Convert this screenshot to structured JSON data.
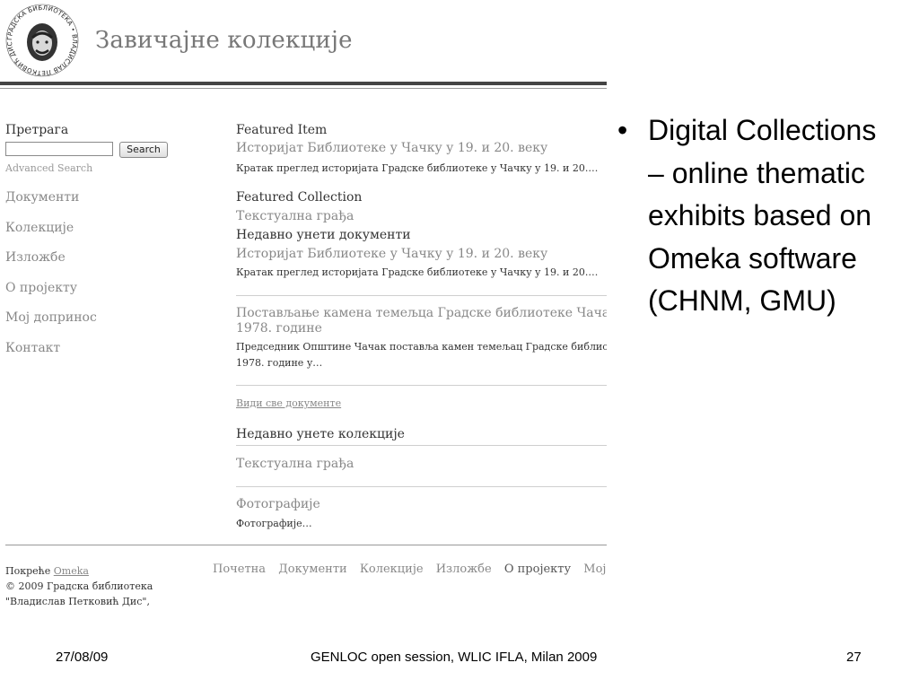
{
  "site": {
    "title": "Завичајне колекције",
    "logo_text": "ГРАДСКА БИБЛИОТЕКА • ВЛАДИСЛАВ ПЕТКОВИЋ ДИС • ЧАЧАК"
  },
  "sidebar": {
    "search_heading": "Претрага",
    "search_value": "",
    "search_button": "Search",
    "advanced_search": "Advanced Search",
    "nav": [
      "Документи",
      "Колекције",
      "Изложбе",
      "О пројекту",
      "Мој допринос",
      "Контакт"
    ]
  },
  "main": {
    "featured_item_heading": "Featured Item",
    "featured_item_title": "Историјат Библиотеке у Чачку у 19. и 20. веку",
    "featured_item_desc": "Кратак преглед историјата Градске библиотеке у Чачку у 19. и 20.…",
    "featured_collection_heading": "Featured Collection",
    "featured_collection_title": "Текстуална грађа",
    "recent_items_heading": "Недавно унети документи",
    "recent_items": [
      {
        "title": "Историјат Библиотеке у Чачку у 19. и 20. веку",
        "desc": "Кратак преглед историјата Градске библиотеке у Чачку у 19. и 20.…"
      },
      {
        "title_line1": "Постављање камена темељца Градске библиотеке Чачак",
        "title_line2": "1978. године",
        "desc_line1": "Председник Општине Чачак поставља камен темељац Градске библиотеке",
        "desc_line2": "1978. године у…"
      }
    ],
    "view_all_link": "Види све документе",
    "recent_collections_heading": "Недавно унете колекције",
    "recent_collections": [
      {
        "title": "Текстуална грађа"
      },
      {
        "title": "Фотографије",
        "desc": "Фотографије…"
      }
    ]
  },
  "footer": {
    "powered_by": "Покреће",
    "omeka_link": "Omeka",
    "copyright_line1": "© 2009 Градска библиотека",
    "copyright_line2": "\"Владислав Петковић Дис\",",
    "nav": [
      "Почетна",
      "Документи",
      "Колекције",
      "Изложбе",
      "О пројекту",
      "Мој до"
    ]
  },
  "slide": {
    "bullet_marker": "•",
    "bullet_text": "Digital Collections – online thematic exhibits based on Omeka software (CHNM, GMU)",
    "date": "27/08/09",
    "session": "GENLOC open session, WLIC IFLA, Milan 2009",
    "page_number": "27"
  }
}
